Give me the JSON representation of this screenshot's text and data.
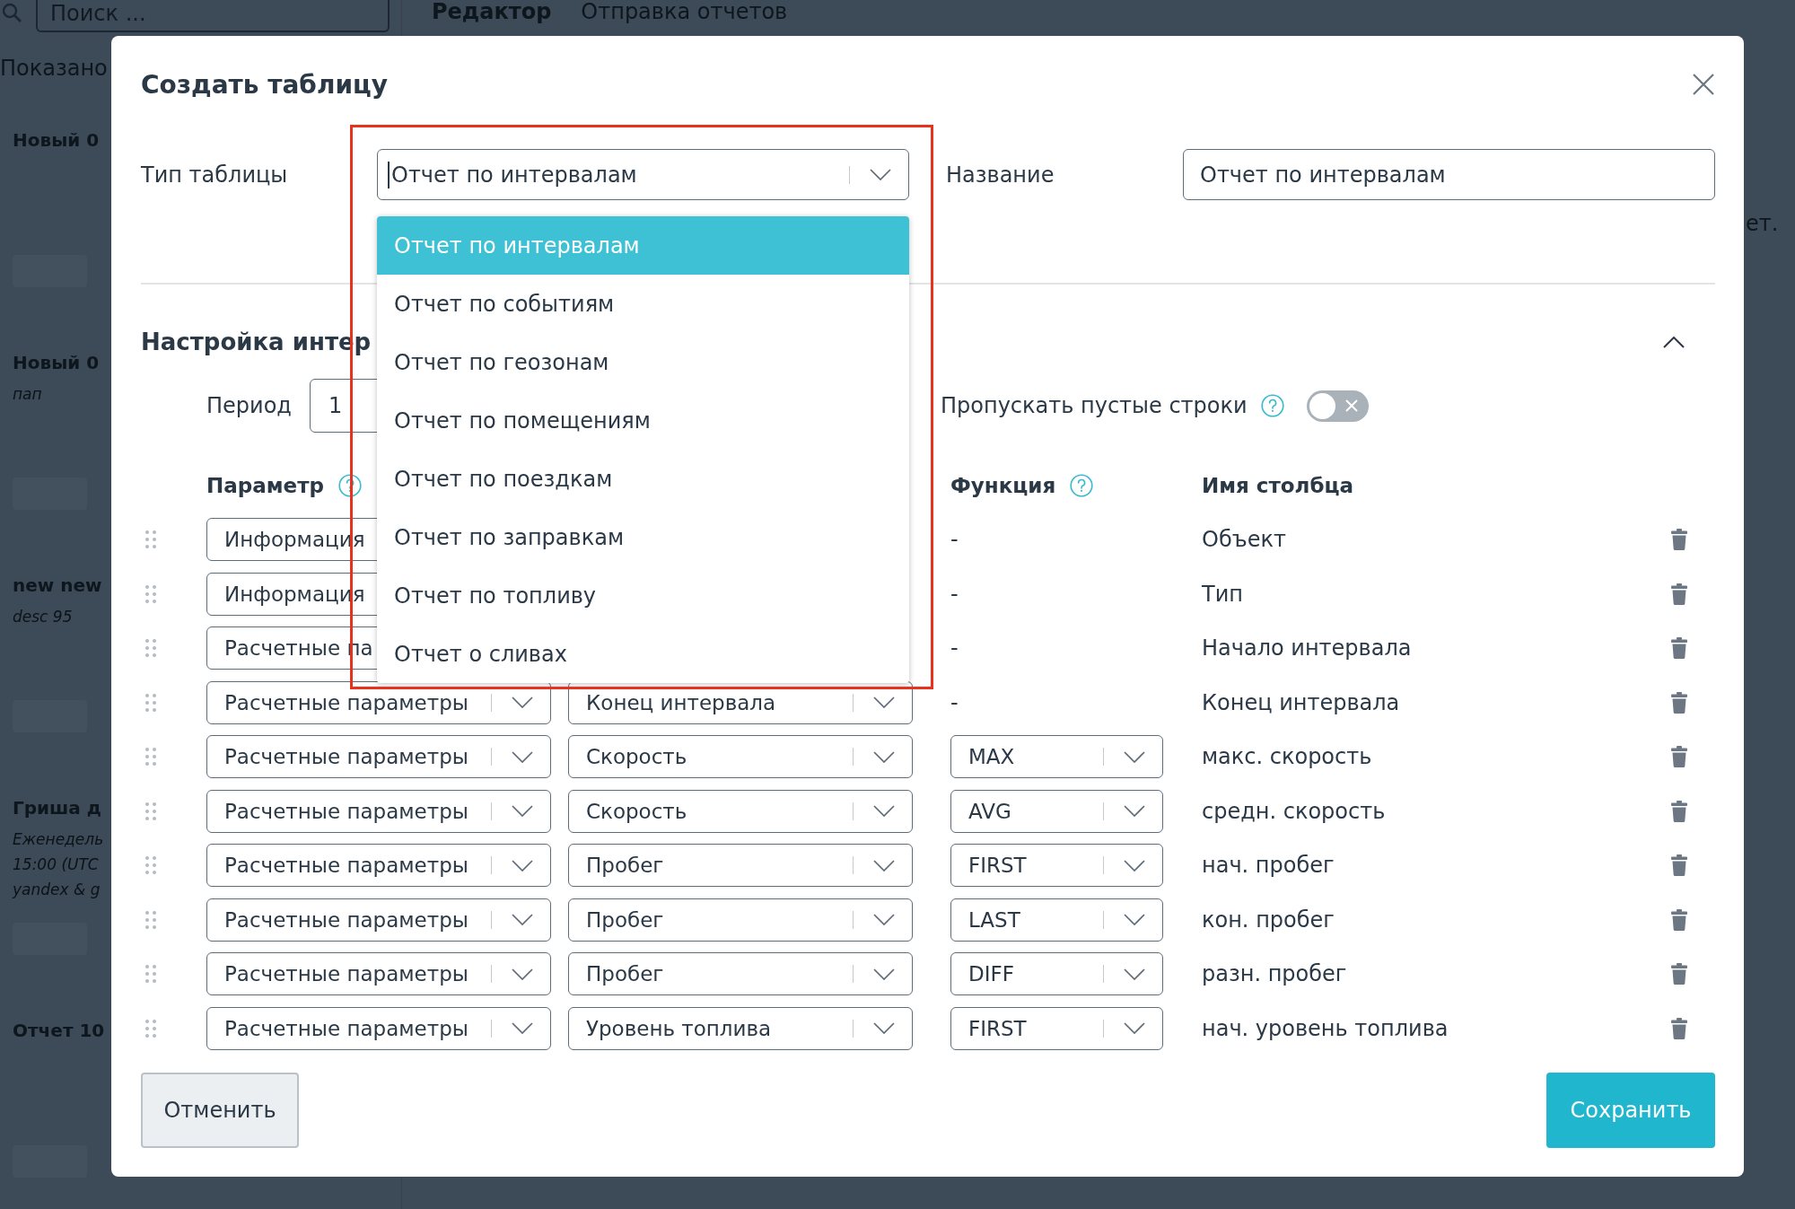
{
  "background": {
    "search": {
      "placeholder": "Поиск ..."
    },
    "tabs": [
      {
        "label": "Редактор",
        "selected": true
      },
      {
        "label": "Отправка отчетов",
        "selected": false
      }
    ],
    "list_caption": "Показано",
    "reports": [
      {
        "title": "Новый 0"
      },
      {
        "title": "Новый 0",
        "details": [
          "пап"
        ]
      },
      {
        "title": "new new",
        "details": [
          "desc 95"
        ]
      },
      {
        "title": "Гриша д",
        "details": [
          "Еженедель",
          "15:00 (UTC",
          "yandex & g"
        ]
      },
      {
        "title": "Отчет 10"
      }
    ],
    "side_text": "ет."
  },
  "dialog": {
    "title": "Создать таблицу",
    "table_type": {
      "label": "Тип таблицы",
      "value": "Отчет по интервалам",
      "focused": true,
      "expanded": true,
      "options": [
        {
          "label": "Отчет по интервалам",
          "selected": true
        },
        {
          "label": "Отчет по событиям",
          "selected": false
        },
        {
          "label": "Отчет по геозонам",
          "selected": false
        },
        {
          "label": "Отчет по помещениям",
          "selected": false
        },
        {
          "label": "Отчет по поездкам",
          "selected": false
        },
        {
          "label": "Отчет по заправкам",
          "selected": false
        },
        {
          "label": "Отчет по топливу",
          "selected": false
        },
        {
          "label": "Отчет о сливах",
          "selected": false
        }
      ]
    },
    "name": {
      "label": "Название",
      "value": "Отчет по интервалам"
    },
    "section": {
      "title": "Настройка интер",
      "expanded": true
    },
    "period": {
      "label": "Период",
      "value": "1"
    },
    "skip_empty_rows": {
      "label": "Пропускать пустые строки",
      "help": true,
      "on": false
    },
    "headers": {
      "parameter": {
        "label": "Параметр",
        "help": true
      },
      "function": {
        "label": "Функция",
        "help": true
      },
      "column_name": {
        "label": "Имя столбца"
      }
    },
    "rows": [
      {
        "kind": "static",
        "parameter": "Информация",
        "function": "-",
        "column_name": "Объект"
      },
      {
        "kind": "static",
        "parameter": "Информация",
        "function": "-",
        "column_name": "Тип"
      },
      {
        "kind": "static",
        "parameter": "Расчетные па",
        "function": "-",
        "column_name": "Начало интервала"
      },
      {
        "kind": "static",
        "parameter": "Расчетные параметры",
        "field": "Конец интервала",
        "function": "-",
        "column_name": "Конец интервала"
      },
      {
        "kind": "aggregate",
        "parameter": "Расчетные параметры",
        "field": "Скорость",
        "function": "MAX",
        "column_name": "макс. скорость"
      },
      {
        "kind": "aggregate",
        "parameter": "Расчетные параметры",
        "field": "Скорость",
        "function": "AVG",
        "column_name": "средн. скорость"
      },
      {
        "kind": "aggregate",
        "parameter": "Расчетные параметры",
        "field": "Пробег",
        "function": "FIRST",
        "column_name": "нач. пробег"
      },
      {
        "kind": "aggregate",
        "parameter": "Расчетные параметры",
        "field": "Пробег",
        "function": "LAST",
        "column_name": "кон. пробег"
      },
      {
        "kind": "aggregate",
        "parameter": "Расчетные параметры",
        "field": "Пробег",
        "function": "DIFF",
        "column_name": "разн. пробег"
      },
      {
        "kind": "aggregate",
        "parameter": "Расчетные параметры",
        "field": "Уровень топлива",
        "function": "FIRST",
        "column_name": "нач. уровень топлива"
      }
    ],
    "buttons": [
      {
        "label": "Отменить",
        "kind": "secondary"
      },
      {
        "label": "Сохранить",
        "kind": "primary"
      }
    ]
  },
  "annotations": [
    {
      "kind": "frame"
    }
  ]
}
